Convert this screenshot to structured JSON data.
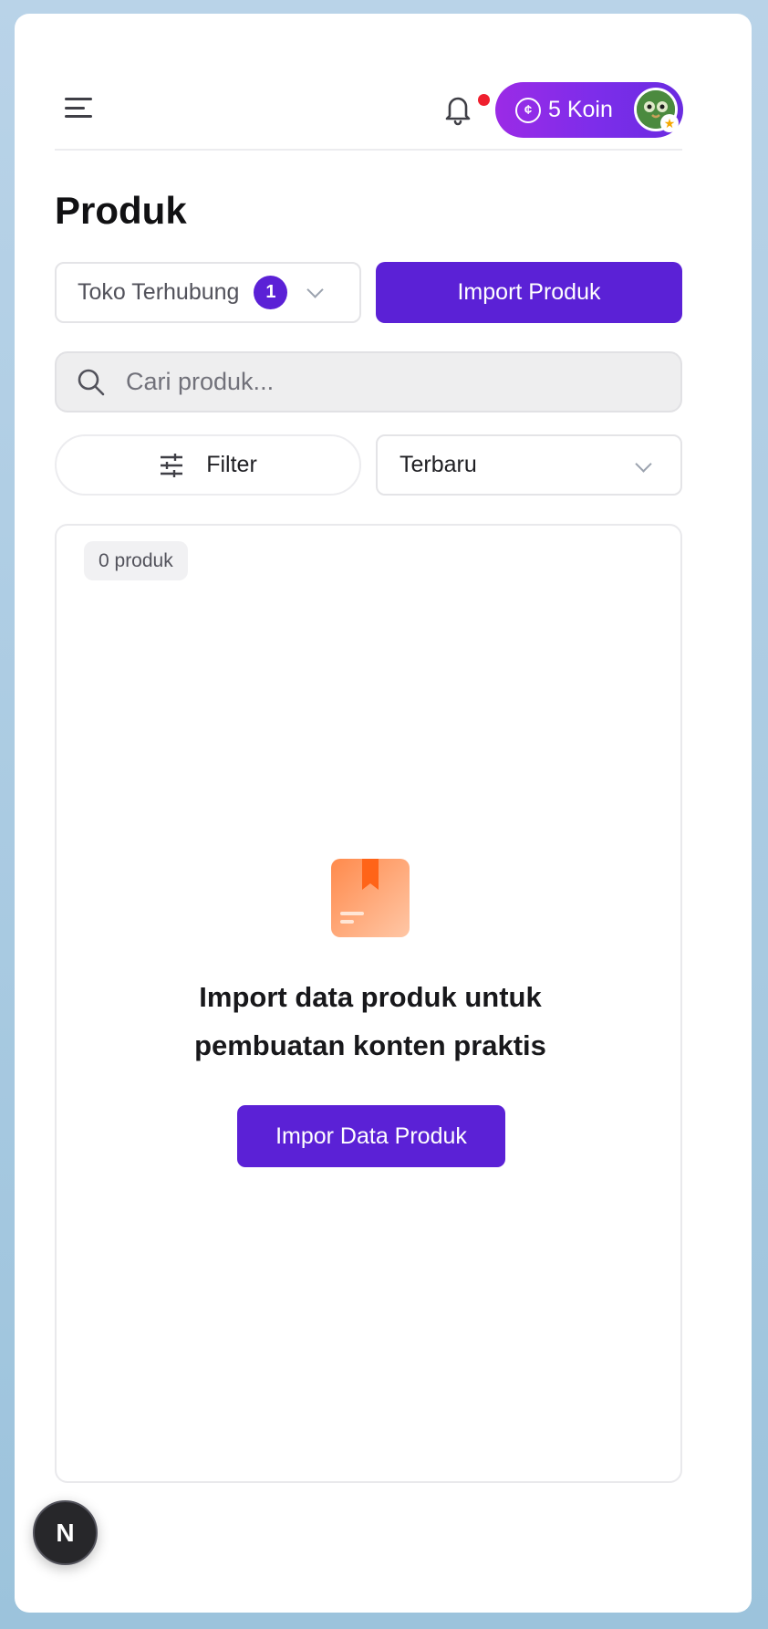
{
  "header": {
    "koin_label": "5 Koin",
    "koin_icon_glyph": "¢",
    "has_notification": true
  },
  "page": {
    "title": "Produk"
  },
  "toolbar": {
    "store_select_label": "Toko Terhubung",
    "store_count": "1",
    "import_label": "Import Produk",
    "search_placeholder": "Cari produk...",
    "filter_label": "Filter",
    "sort_value": "Terbaru"
  },
  "panel": {
    "count_label": "0 produk",
    "empty_title": "Import data produk untuk pembuatan konten praktis",
    "empty_button": "Impor Data Produk"
  },
  "dev_badge": {
    "letter": "N"
  },
  "colors": {
    "primary": "#5b21d6",
    "koin_gradient_start": "#9b2be6",
    "notification_dot": "#ef1f2e",
    "empty_icon": "#ff8a4c"
  }
}
